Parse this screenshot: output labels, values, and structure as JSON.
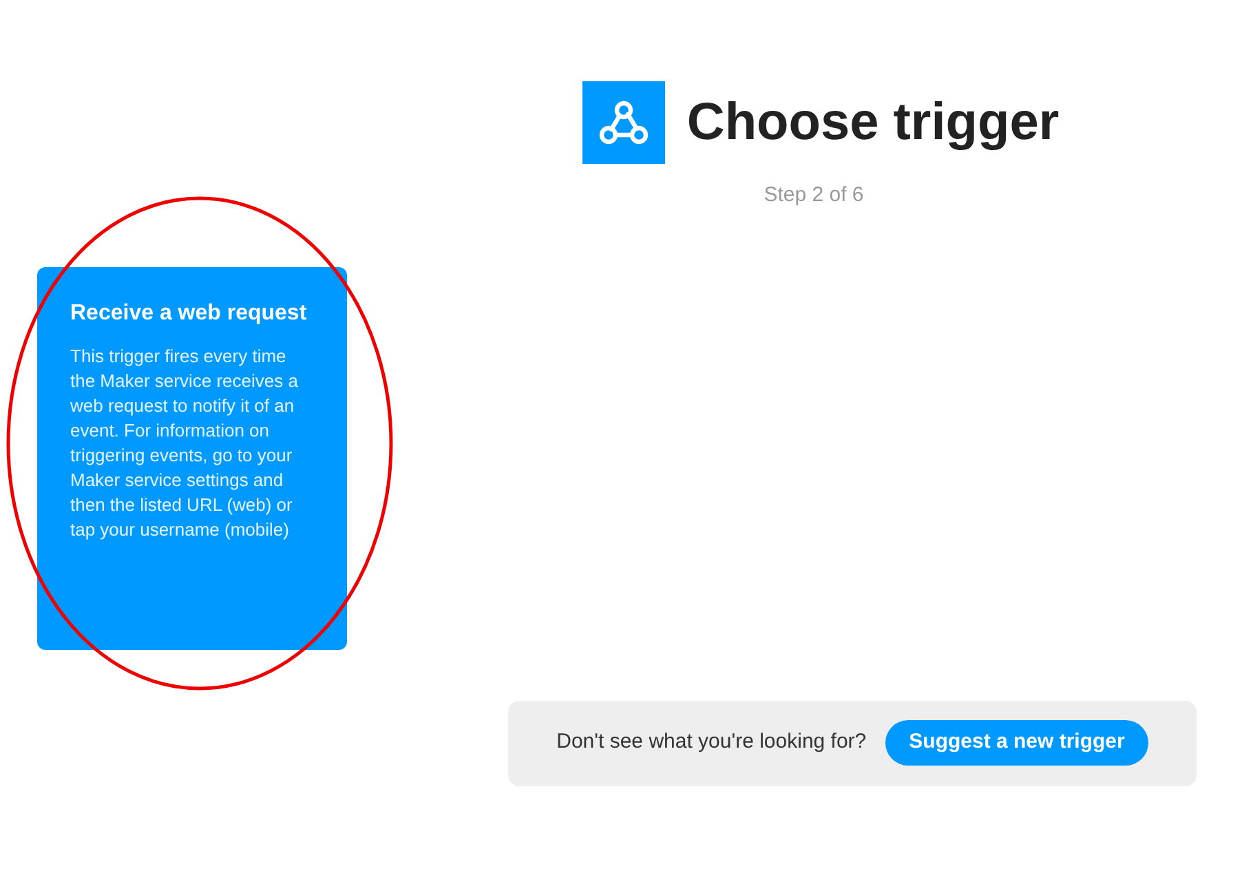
{
  "header": {
    "title": "Choose trigger",
    "step": "Step 2 of 6"
  },
  "triggers": [
    {
      "title": "Receive a web request",
      "description": "This trigger fires every time the Maker service receives a web request to notify it of an event. For information on triggering events, go to your Maker service settings and then the listed URL (web) or tap your username (mobile)"
    }
  ],
  "annotation": {
    "kind": "ellipse",
    "color": "#ee0000"
  },
  "suggest": {
    "prompt": "Don't see what you're looking for?",
    "button": "Suggest a new trigger"
  }
}
